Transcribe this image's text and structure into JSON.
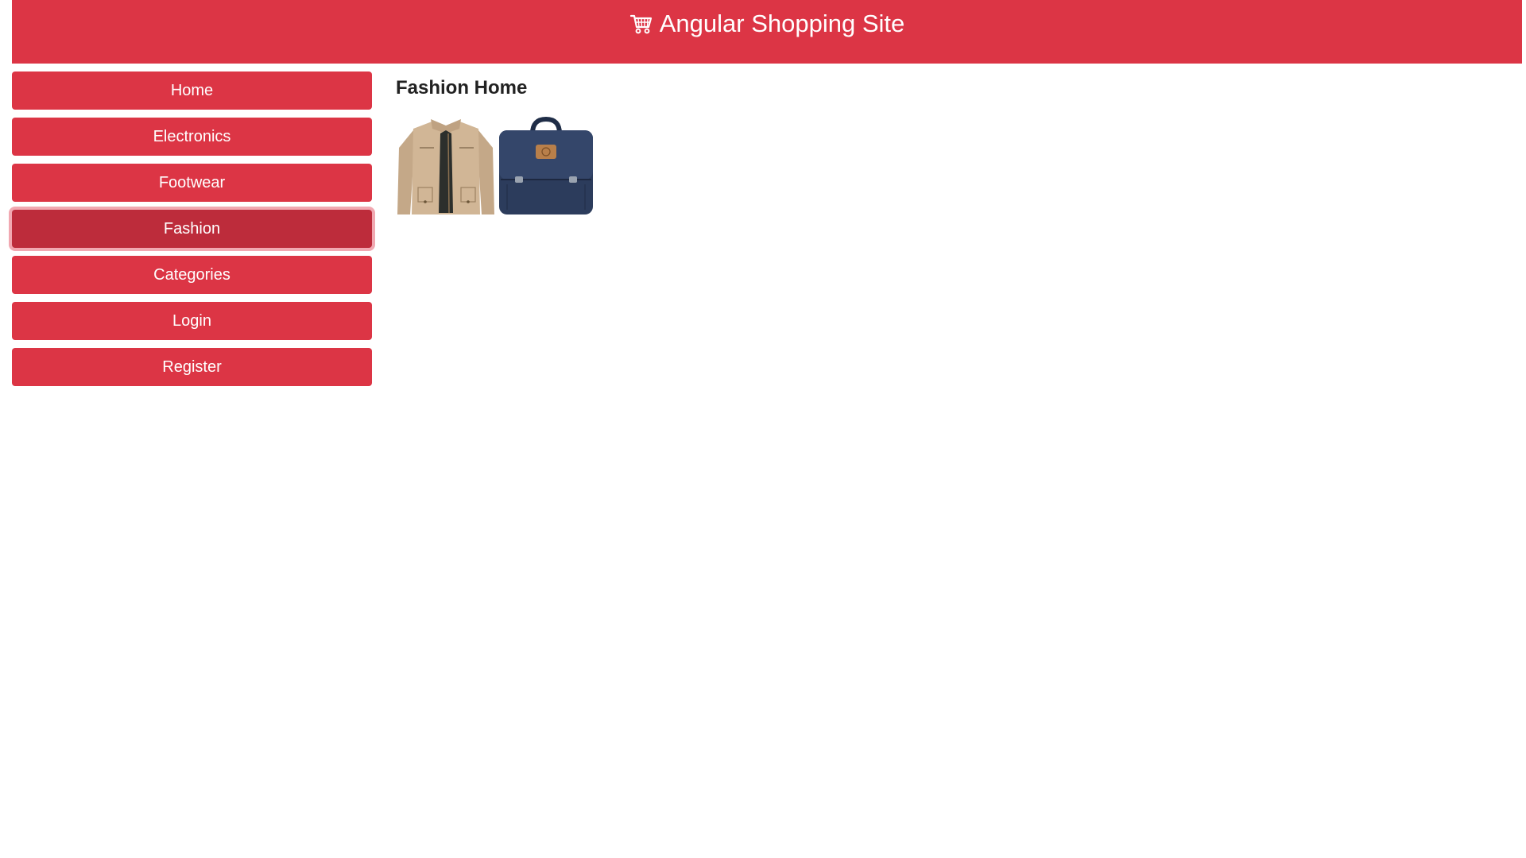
{
  "header": {
    "title": "Angular Shopping Site",
    "icon": "shopping-cart-icon",
    "background": "#dc3545"
  },
  "sidebar": {
    "items": [
      {
        "label": "Home",
        "active": false
      },
      {
        "label": "Electronics",
        "active": false
      },
      {
        "label": "Footwear",
        "active": false
      },
      {
        "label": "Fashion",
        "active": true
      },
      {
        "label": "Categories",
        "active": false
      },
      {
        "label": "Login",
        "active": false
      },
      {
        "label": "Register",
        "active": false
      }
    ]
  },
  "main": {
    "title": "Fashion Home",
    "products": [
      {
        "icon": "jacket-image"
      },
      {
        "icon": "backpack-image"
      }
    ]
  },
  "colors": {
    "accent": "#dc3545",
    "active": "#bd2c3b",
    "focus_ring": "#f1a8b1"
  }
}
